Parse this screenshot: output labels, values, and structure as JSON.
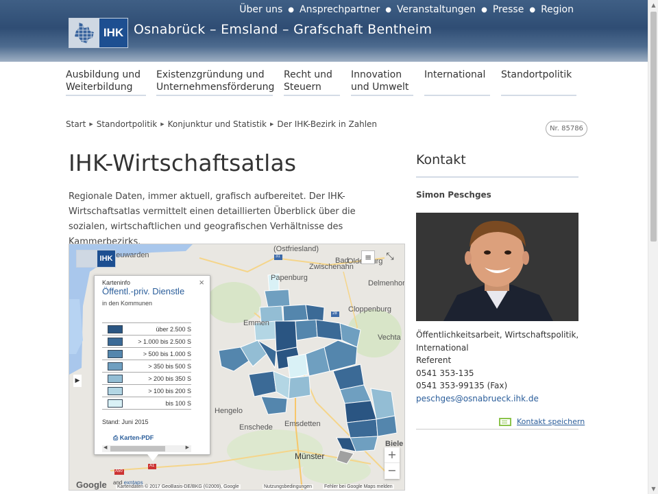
{
  "topnav": [
    "Über uns",
    "Ansprechpartner",
    "Veranstaltungen",
    "Presse",
    "Region"
  ],
  "brand": {
    "logo_text": "IHK",
    "title": "Osnabrück – Emsland – Grafschaft Bentheim"
  },
  "mainnav": [
    {
      "line1": "Ausbildung und",
      "line2": "Weiterbildung"
    },
    {
      "line1": "Existenzgründung und",
      "line2": "Unternehmensförderung"
    },
    {
      "line1": "Recht und",
      "line2": "Steuern"
    },
    {
      "line1": "Innovation",
      "line2": "und Umwelt"
    },
    {
      "line1": "International",
      "line2": ""
    },
    {
      "line1": "Standortpolitik",
      "line2": ""
    }
  ],
  "breadcrumb": [
    "Start",
    "Standortpolitik",
    "Konjunktur und Statistik",
    "Der IHK-Bezirk in Zahlen"
  ],
  "page_number": "Nr. 85786",
  "page_title": "IHK-Wirtschaftsatlas",
  "intro": "Regionale Daten, immer aktuell, grafisch aufbereitet. Der IHK-Wirtschaftsatlas vermittelt einen detaillierten Überblick über die sozialen, wirtschaftlichen und geografischen Verhältnisse des Kammerbezirks.",
  "map": {
    "logo_text": "IHK",
    "places": [
      "Leeuwarden",
      "(Ostfriesland)",
      "Bad",
      "Zwischenahn",
      "Oldenburg",
      "Papenburg",
      "Delmenhorst",
      "Cloppenburg",
      "Emmen",
      "Vechta",
      "Hengelo",
      "Enschede",
      "Emsdetten",
      "Münster",
      "Biele"
    ],
    "road_labels": [
      "31",
      "28",
      "A1",
      "A50"
    ],
    "infobox": {
      "kicker": "Karteninfo",
      "title": "Öffentl.-priv. Dienstle",
      "subtitle": "in den Kommunen",
      "legend": [
        {
          "label": "über 2.500 S",
          "color": "#2a5582"
        },
        {
          "label": "> 1.000 bis 2.500 S",
          "color": "#3b6a96"
        },
        {
          "label": "> 500 bis 1.000 S",
          "color": "#5486ad"
        },
        {
          "label": "> 350 bis 500 S",
          "color": "#6f9fc0"
        },
        {
          "label": "> 200 bis 350 S",
          "color": "#93bdd4"
        },
        {
          "label": "> 100 bis 200 S",
          "color": "#b3d6e4"
        },
        {
          "label": "bis 100 S",
          "color": "#d9f1f6"
        }
      ],
      "stand": "Stand: Juni 2015",
      "pdf_label": "Karten-PDF"
    },
    "attribution": {
      "google": "Google",
      "extra": "and ",
      "link": "exntaps",
      "data": "Kartendaten © 2017 GeoBasis-DE/BKG (©2009), Google",
      "terms": "Nutzungsbedingungen",
      "report": "Fehler bei Google Maps melden"
    }
  },
  "sidebar": {
    "title": "Kontakt",
    "name": "Simon Peschges",
    "role": "Öffentlichkeitsarbeit, Wirtschaftspolitik, International",
    "position": "Referent",
    "phone": "0541 353-135",
    "fax": "0541 353-99135 (Fax)",
    "email": "peschges@osnabrueck.ihk.de",
    "save_label": "Kontakt speichern"
  }
}
